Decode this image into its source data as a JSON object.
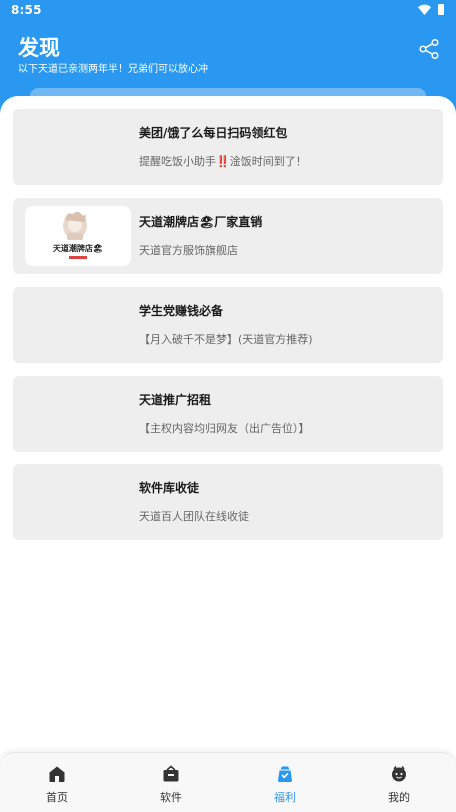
{
  "status_bar": {
    "time": "8:55"
  },
  "header": {
    "title": "发现",
    "subtitle": "以下天道已亲测两年半！兄弟们可以放心冲"
  },
  "cards": [
    {
      "title": "美团/饿了么每日扫码领红包",
      "desc": "提醒吃饭小助手‼️淦饭时间到了！",
      "thumb": ""
    },
    {
      "title": "天道潮牌店🏖厂家直销",
      "desc": "天道官方服饰旗舰店",
      "thumb": "天道潮牌店🏖"
    },
    {
      "title": "学生党赚钱必备",
      "desc": "【月入破千不是梦】(天道官方推荐)",
      "thumb": ""
    },
    {
      "title": "天道推广招租",
      "desc": "【主权内容均归网友（出广告位）】",
      "thumb": ""
    },
    {
      "title": "软件库收徒",
      "desc": "天道百人团队在线收徒",
      "thumb": ""
    }
  ],
  "nav": [
    {
      "label": "首页",
      "icon": "home-icon"
    },
    {
      "label": "软件",
      "icon": "software-box-icon"
    },
    {
      "label": "福利",
      "icon": "welfare-bag-icon",
      "active": true
    },
    {
      "label": "我的",
      "icon": "profile-icon"
    }
  ],
  "colors": {
    "accent": "#2a98f0",
    "card_bg": "#eeeeee"
  }
}
